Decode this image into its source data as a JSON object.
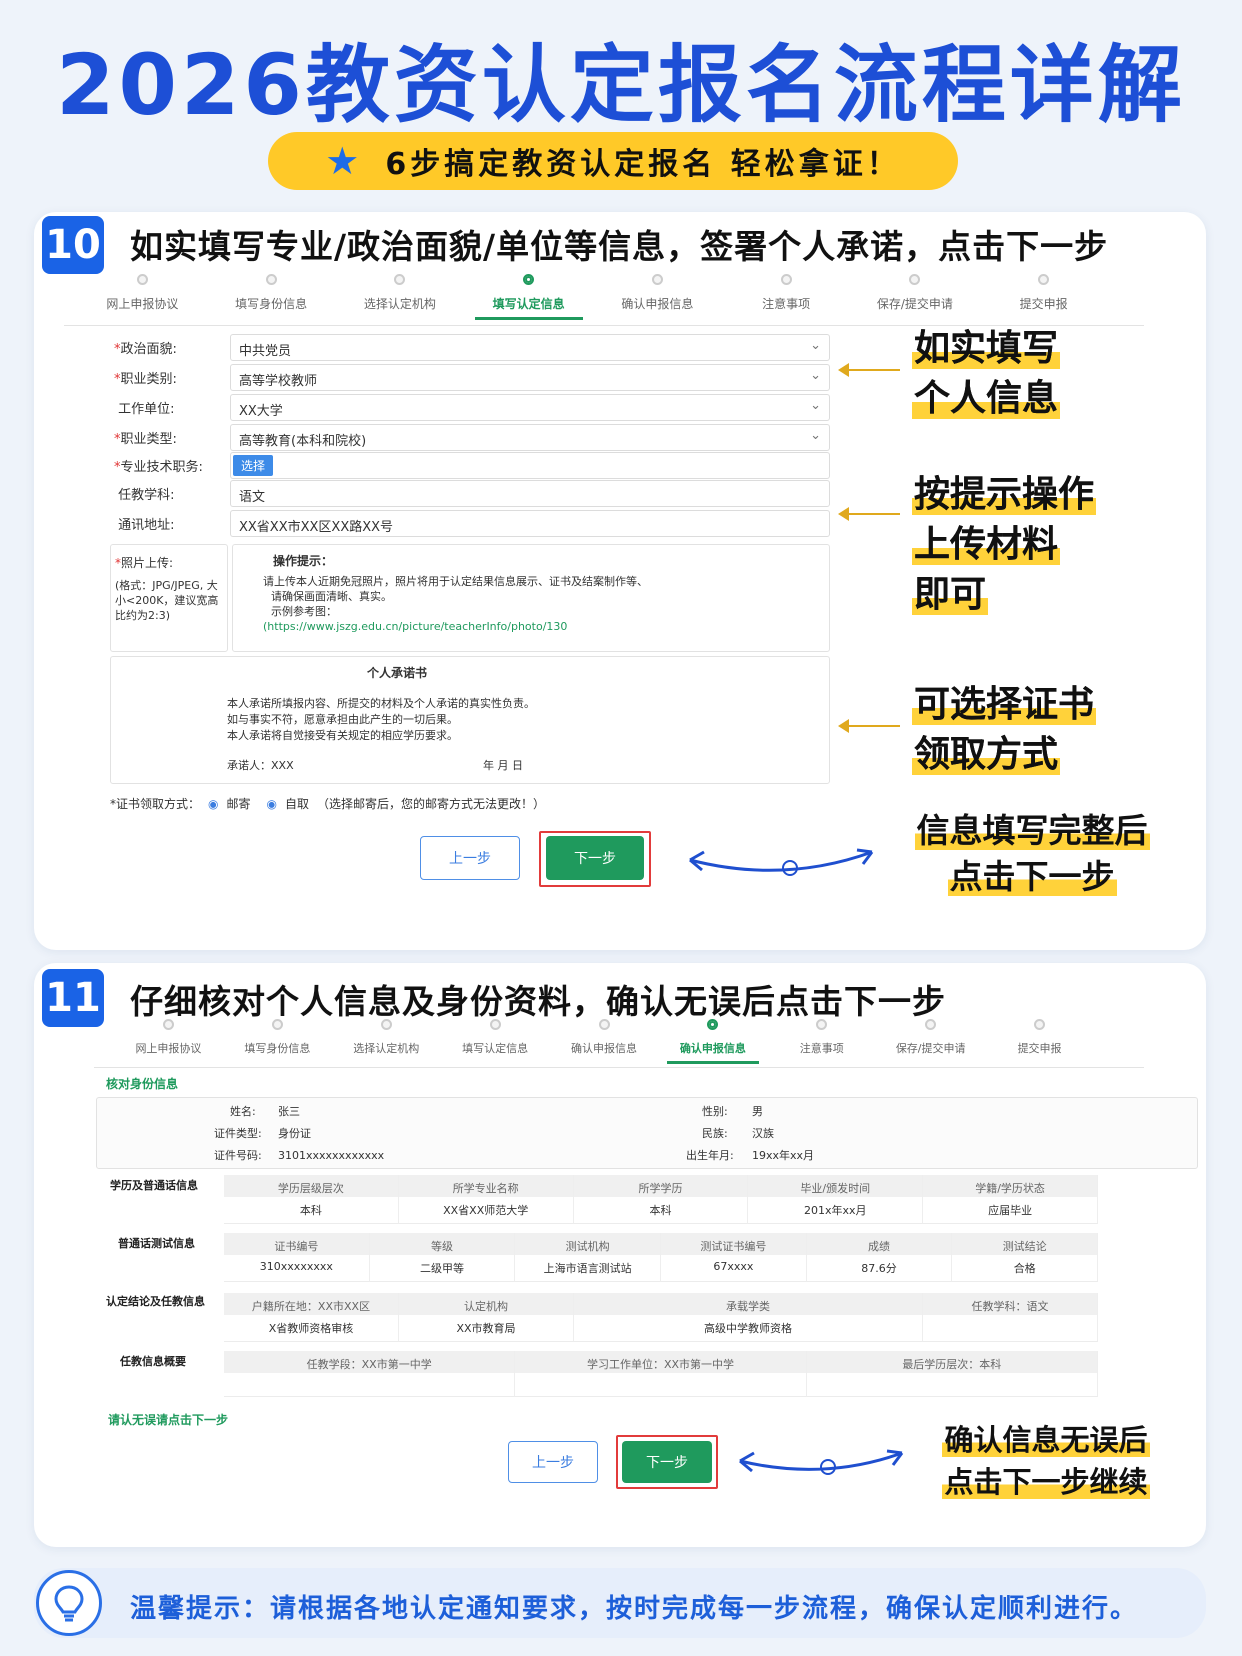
{
  "title": "2026教资认定报名流程详解",
  "banner": "6步搞定教资认定报名  轻松拿证！",
  "progress_steps": [
    "网上申报协议",
    "填写身份信息",
    "选择认定机构",
    "填写认定信息",
    "确认申报信息",
    "注意事项",
    "保存/提交申请",
    "提交申报"
  ],
  "step10": {
    "num": "10",
    "heading": "如实填写专业/政治面貌/单位等信息，签署个人承诺，点击下一步",
    "active_step": "填写认定信息",
    "fields": [
      {
        "label": "政治面貌:",
        "value": "中共党员"
      },
      {
        "label": "职业类别:",
        "value": "高等学校教师"
      },
      {
        "label": "工作单位:",
        "value": "XX大学"
      },
      {
        "label": "职业类型:",
        "value": "高等教育(本科和院校)"
      },
      {
        "label": "专业技术职务:",
        "value": "选择"
      },
      {
        "label": "任教学科:",
        "value": "语文"
      },
      {
        "label": "通讯地址:",
        "value": "XX省XX市XX区XX路XX号"
      }
    ],
    "photo_label": "照片上传:",
    "photo_format": "(格式：JPG/JPEG, 大小<200K，建议宽高比约为2:3)",
    "op_tip_title": "操作提示：",
    "op_tip_line1": "请上传本人近期免冠照片，照片将用于认定结果信息展示、证书及结案制作等、",
    "op_tip_line2": "请确保画面清晰、真实。",
    "op_tip_line3": "示例参考图：",
    "op_tip_link": "(https://www.jszg.edu.cn/picture/teacherInfo/photo/130",
    "promise_title": "个人承诺书",
    "promise_line1": "本人承诺所填报内容、所提交的材料及个人承诺的真实性负责。",
    "promise_line2": "如与事实不符，愿意承担由此产生的一切后果。",
    "promise_line3": "本人承诺将自觉接受有关规定的相应学历要求。",
    "promise_signer": "承诺人：XXX",
    "promise_date": "年  月  日",
    "cert_label": "*证书领取方式：",
    "cert_opt1": "邮寄",
    "cert_opt2": "自取",
    "cert_note": "（选择邮寄后，您的邮寄方式无法更改！）",
    "prev_btn": "上一步",
    "next_btn": "下一步",
    "note1_l1": "如实填写",
    "note1_l2": "个人信息",
    "note2_l1": "按提示操作",
    "note2_l2": "上传材料",
    "note2_l3": "即可",
    "note3_l1": "可选择证书",
    "note3_l2": "领取方式",
    "note4_l1": "信息填写完整后",
    "note4_l2": "点击下一步"
  },
  "step11": {
    "num": "11",
    "heading": "仔细核对个人信息及身份资料，确认无误后点击下一步",
    "active_step": "确认申报信息",
    "section_title": "核对身份信息",
    "identity": {
      "name_label": "姓名:",
      "name": "张三",
      "idtype_label": "证件类型:",
      "idtype": "身份证",
      "idno_label": "证件号码:",
      "idno": "3101xxxxxxxxxxxx",
      "gender_label": "性别:",
      "gender": "男",
      "ethnic_label": "民族:",
      "ethnic": "汉族",
      "birth_label": "出生年月:",
      "birth": "19xx年xx月"
    },
    "edu_label": "学历及普通话信息",
    "edu_head": [
      "学历层级层次",
      "所学专业名称",
      "所学学历",
      "毕业/颁发时间",
      "学籍/学历状态"
    ],
    "edu_row": [
      "本科",
      "XX省XX师范大学",
      "本科",
      "201x年xx月",
      "应届毕业"
    ],
    "pth_label": "普通话测试信息",
    "pth_head": [
      "证书编号",
      "等级",
      "测试机构",
      "测试证书编号",
      "成绩",
      "测试结论"
    ],
    "pth_row": [
      "310xxxxxxxx",
      "二级甲等",
      "上海市语言测试站",
      "67xxxx",
      "87.6分",
      "合格"
    ],
    "cert_label": "认定结论及任教信息",
    "cert_head": [
      "户籍所在地：XX市XX区",
      "认定机构",
      "承载学类",
      "任教学科：语文"
    ],
    "cert_row": [
      "X省教师资格审核",
      "XX市教育局",
      "高级中学教师资格",
      ""
    ],
    "teach_label": "任教信息概要",
    "teach_head": [
      "任教学段：XX市第一中学",
      "学习工作单位：XX市第一中学",
      "最后学历层次：本科"
    ],
    "confirm_hint": "请认无误请点击下一步",
    "prev_btn": "上一步",
    "next_btn": "下一步",
    "note_l1": "确认信息无误后",
    "note_l2": "点击下一步继续"
  },
  "tip": "温馨提示：请根据各地认定通知要求，按时完成每一步流程，确保认定顺利进行。",
  "colors": {
    "brand_blue": "#1d4fd6",
    "accent_yellow": "#ffc928",
    "green": "#1f9a5d",
    "red": "#e23b3b"
  }
}
